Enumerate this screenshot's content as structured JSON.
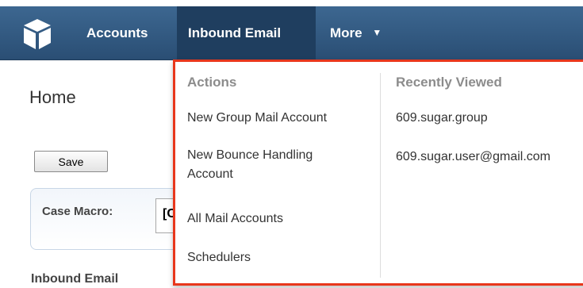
{
  "nav": {
    "items": [
      {
        "label": "Accounts"
      },
      {
        "label": "Inbound Email"
      },
      {
        "label": "More"
      }
    ]
  },
  "page": {
    "title": "Home",
    "save_label": "Save",
    "panel_label": "Case Macro:",
    "panel_field_value": "[C",
    "section_title": "Inbound Email"
  },
  "dropdown": {
    "actions_header": "Actions",
    "recent_header": "Recently Viewed",
    "actions": [
      {
        "label": "New Group Mail Account"
      },
      {
        "label": "New Bounce Handling Account"
      },
      {
        "label": "All Mail Accounts"
      },
      {
        "label": "Schedulers"
      }
    ],
    "recent": [
      {
        "label": "609.sugar.group"
      },
      {
        "label": "609.sugar.user@gmail.com"
      }
    ]
  },
  "colors": {
    "nav_bg": "#2f5680",
    "nav_active": "#1f3e5f",
    "highlight_border": "#e8371c"
  }
}
